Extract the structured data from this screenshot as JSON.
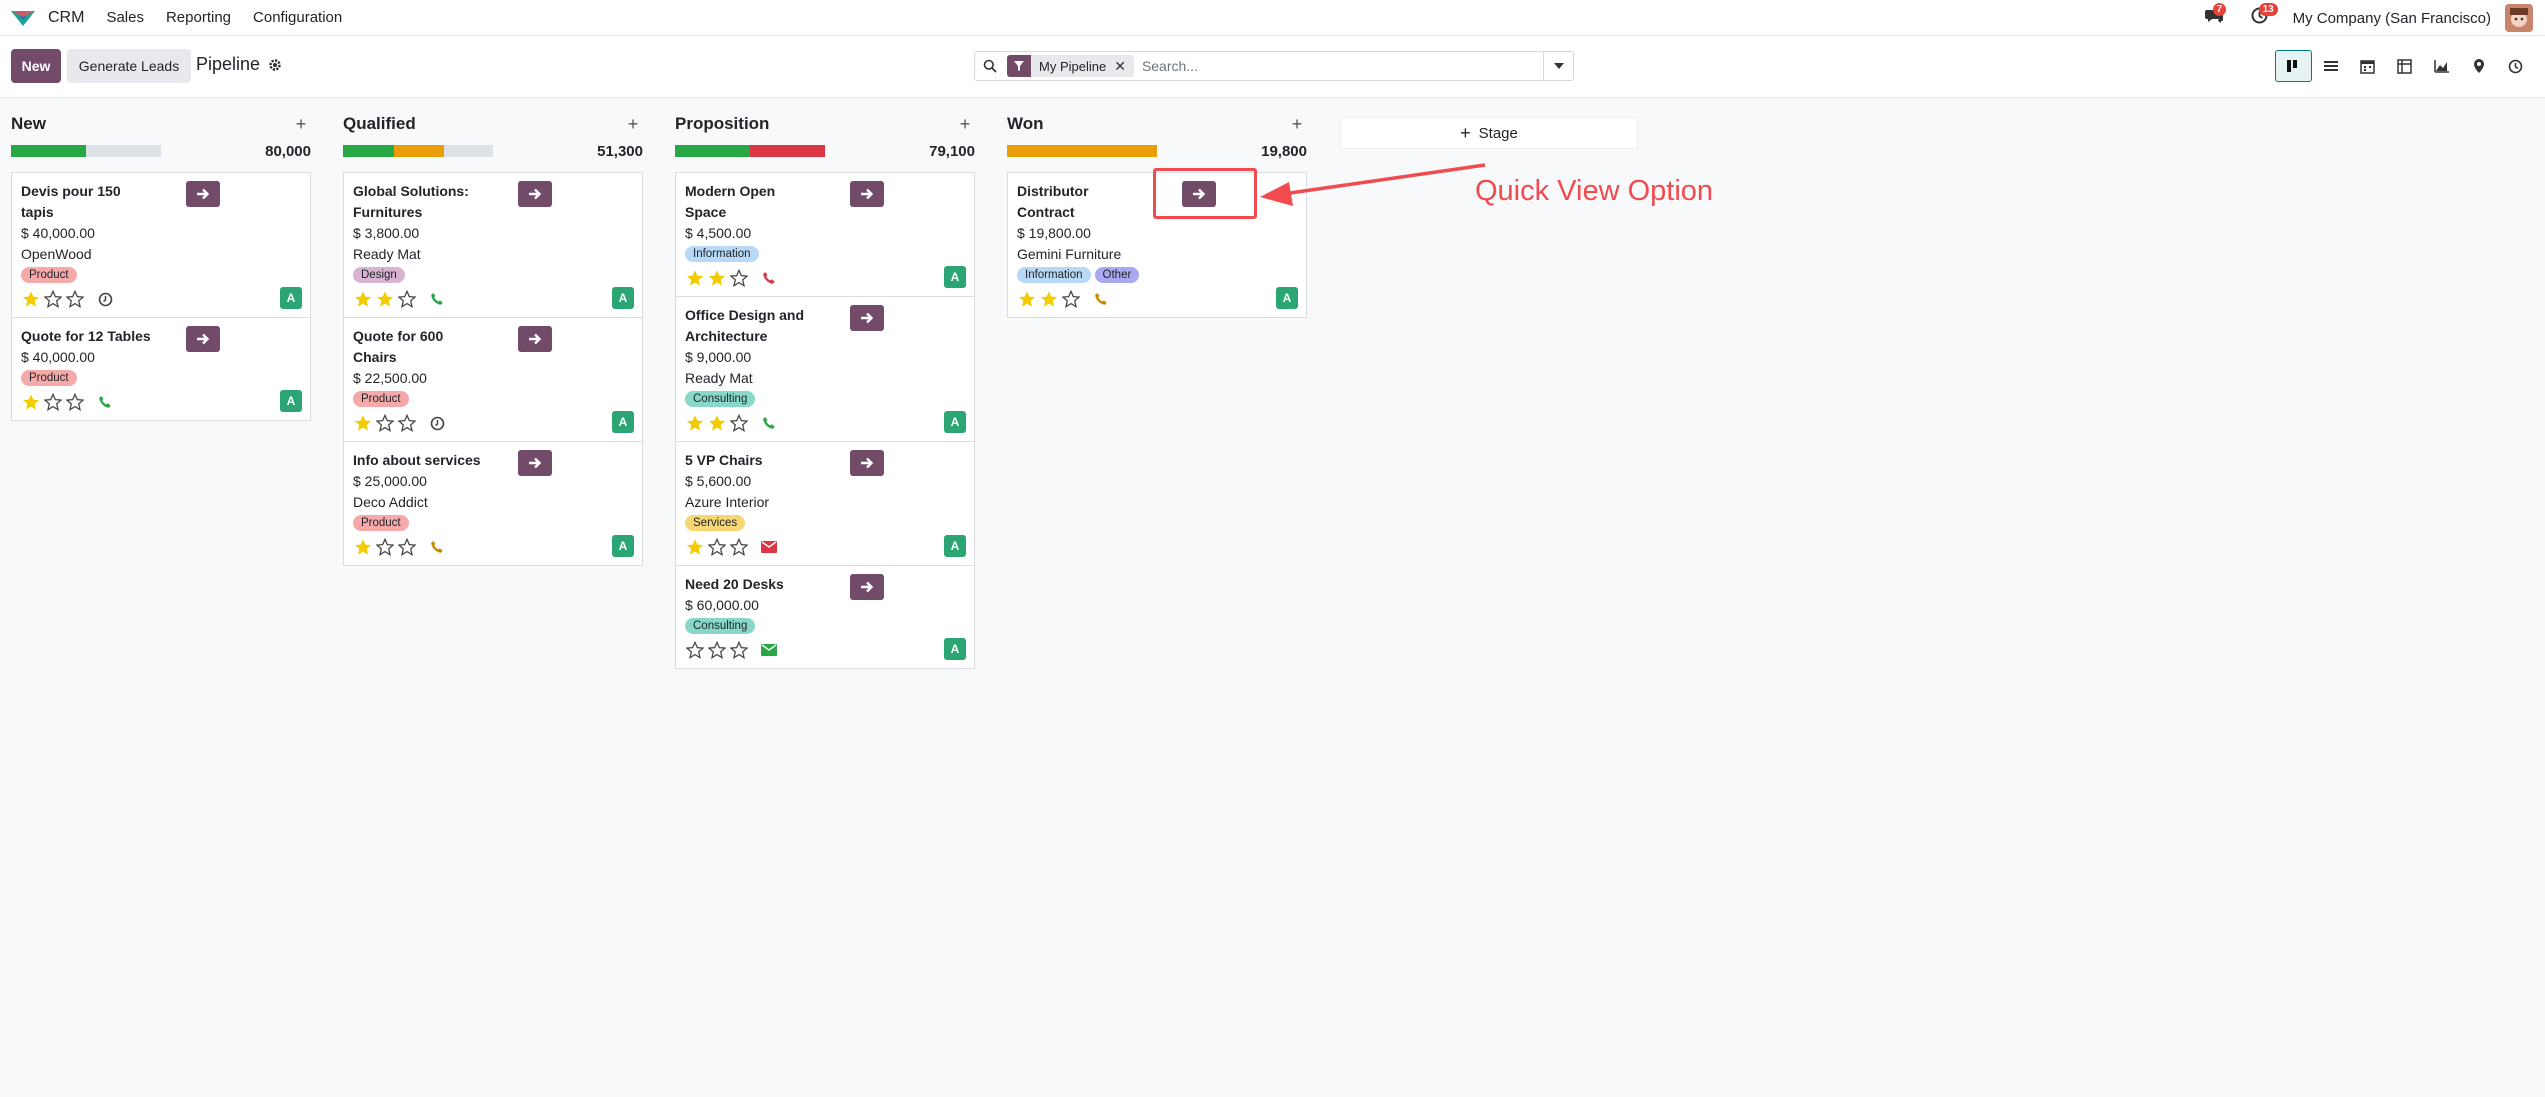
{
  "app": {
    "name": "CRM",
    "menu": [
      "Sales",
      "Reporting",
      "Configuration"
    ]
  },
  "systray": {
    "messages_count": "7",
    "activities_count": "13",
    "company": "My Company (San Francisco)"
  },
  "control": {
    "new_label": "New",
    "generate_label": "Generate Leads",
    "breadcrumb": "Pipeline",
    "search": {
      "facet": "My Pipeline",
      "placeholder": "Search..."
    },
    "views": [
      "kanban",
      "list",
      "calendar",
      "pivot",
      "graph",
      "map",
      "activity"
    ]
  },
  "stage_button": "Stage",
  "annotation": "Quick View Option",
  "colors": {
    "accent": "#714b67",
    "annotation": "#f24b4f",
    "green": "#28a745",
    "orange": "#e99d06",
    "red": "#dc3545"
  },
  "columns": [
    {
      "title": "New",
      "total": "80,000",
      "progress": [
        {
          "color": "#28a745",
          "fraction": 0.5
        },
        {
          "color": "#dee2e6",
          "fraction": 0.5
        }
      ],
      "cards": [
        {
          "title": "Devis pour 150 tapis",
          "amount": "$ 40,000.00",
          "partner": "OpenWood",
          "tags": [
            {
              "label": "Product",
              "color": "#f6a9a9"
            }
          ],
          "stars": 1,
          "activity": "clock"
        },
        {
          "title": "Quote for 12 Tables",
          "amount": "$ 40,000.00",
          "partner": "",
          "tags": [
            {
              "label": "Product",
              "color": "#f6a9a9"
            }
          ],
          "stars": 1,
          "activity": "phone-green"
        }
      ]
    },
    {
      "title": "Qualified",
      "total": "51,300",
      "progress": [
        {
          "color": "#28a745",
          "fraction": 0.34
        },
        {
          "color": "#e99d06",
          "fraction": 0.33
        },
        {
          "color": "#dee2e6",
          "fraction": 0.33
        }
      ],
      "cards": [
        {
          "title": "Global Solutions: Furnitures",
          "amount": "$ 3,800.00",
          "partner": "Ready Mat",
          "tags": [
            {
              "label": "Design",
              "color": "#d9b4d1"
            }
          ],
          "stars": 2,
          "activity": "phone-green"
        },
        {
          "title": "Quote for 600 Chairs",
          "amount": "$ 22,500.00",
          "partner": "",
          "tags": [
            {
              "label": "Product",
              "color": "#f6a9a9"
            }
          ],
          "stars": 1,
          "activity": "clock"
        },
        {
          "title": "Info about services",
          "amount": "$ 25,000.00",
          "partner": "Deco Addict",
          "tags": [
            {
              "label": "Product",
              "color": "#f6a9a9"
            }
          ],
          "stars": 1,
          "activity": "phone-orange"
        }
      ]
    },
    {
      "title": "Proposition",
      "total": "79,100",
      "progress": [
        {
          "color": "#28a745",
          "fraction": 0.5
        },
        {
          "color": "#dc3545",
          "fraction": 0.5
        }
      ],
      "cards": [
        {
          "title": "Modern Open Space",
          "amount": "$ 4,500.00",
          "partner": "",
          "tags": [
            {
              "label": "Information",
              "color": "#b7d9f5"
            }
          ],
          "stars": 2,
          "activity": "phone-red"
        },
        {
          "title": "Office Design and Architecture",
          "amount": "$ 9,000.00",
          "partner": "Ready Mat",
          "tags": [
            {
              "label": "Consulting",
              "color": "#88d8c9"
            }
          ],
          "stars": 2,
          "activity": "phone-green"
        },
        {
          "title": "5 VP Chairs",
          "amount": "$ 5,600.00",
          "partner": "Azure Interior",
          "tags": [
            {
              "label": "Services",
              "color": "#f7d774"
            }
          ],
          "stars": 1,
          "activity": "mail-red"
        },
        {
          "title": "Need 20 Desks",
          "amount": "$ 60,000.00",
          "partner": "",
          "tags": [
            {
              "label": "Consulting",
              "color": "#88d8c9"
            }
          ],
          "stars": 0,
          "activity": "mail-green"
        }
      ]
    },
    {
      "title": "Won",
      "total": "19,800",
      "progress": [
        {
          "color": "#e99d06",
          "fraction": 1.0
        }
      ],
      "cards": [
        {
          "title": "Distributor Contract",
          "amount": "$ 19,800.00",
          "partner": "Gemini Furniture",
          "tags": [
            {
              "label": "Information",
              "color": "#b7d9f5"
            },
            {
              "label": "Other",
              "color": "#a8a9f0"
            }
          ],
          "stars": 2,
          "activity": "phone-orange"
        }
      ]
    }
  ]
}
